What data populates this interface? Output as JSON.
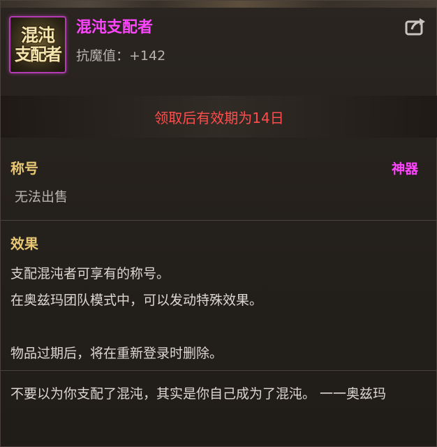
{
  "item": {
    "name": "混沌支配者",
    "icon_text_line1": "混沌",
    "icon_text_line2": "支配者",
    "stat": "抗魔值：+142",
    "share_icon": "share-icon"
  },
  "expire_notice": "领取后有效期为14日",
  "info": {
    "type_label": "称号",
    "rarity": "神器",
    "trade": "无法出售"
  },
  "effect": {
    "title": "效果",
    "lines": [
      "支配混沌者可享有的称号。",
      "在奥兹玛团队模式中，可以发动特殊效果。",
      "物品过期后，将在重新登录时删除。"
    ]
  },
  "flavor_text": "不要以为你支配了混沌，其实是你自己成为了混沌。 一一奥兹玛",
  "colors": {
    "name": "#ff45ff",
    "expire": "#ff4d4d",
    "section_title": "#e8c875",
    "body_text": "#ddd8d0"
  }
}
